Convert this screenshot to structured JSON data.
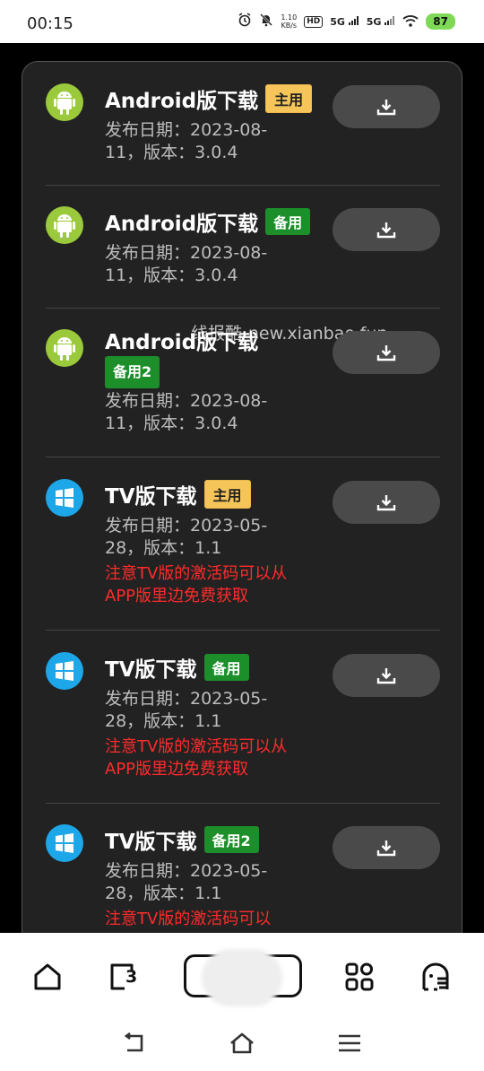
{
  "status_bar": {
    "time": "00:15",
    "net_speed_value": "1.10",
    "net_speed_unit": "KB/s",
    "hd_label": "HD",
    "signal_1": "5G",
    "signal_2": "5G",
    "battery": "87"
  },
  "watermark": "线报酷-new.xianbao.fun",
  "items": [
    {
      "title": "Android版下载",
      "badge": "主用",
      "badge_type": "main",
      "meta": "发布日期：2023-08-11，版本：3.0.4",
      "note": "",
      "icon": "android-icon"
    },
    {
      "title": "Android版下载",
      "badge": "备用",
      "badge_type": "backup",
      "meta": "发布日期：2023-08-11，版本：3.0.4",
      "note": "",
      "icon": "android-icon"
    },
    {
      "title": "Android版下载",
      "badge": "备用2",
      "badge_type": "backup",
      "meta": "发布日期：2023-08-11，版本：3.0.4",
      "note": "",
      "icon": "android-icon"
    },
    {
      "title": "TV版下载",
      "badge": "主用",
      "badge_type": "main",
      "meta": "发布日期：2023-05-28，版本：1.1",
      "note": "注意TV版的激活码可以从APP版里边免费获取",
      "icon": "windows-icon"
    },
    {
      "title": "TV版下载",
      "badge": "备用",
      "badge_type": "backup",
      "meta": "发布日期：2023-05-28，版本：1.1",
      "note": "注意TV版的激活码可以从APP版里边免费获取",
      "icon": "windows-icon"
    },
    {
      "title": "TV版下载",
      "badge": "备用2",
      "badge_type": "backup",
      "meta": "发布日期：2023-05-28，版本：1.1",
      "note": "注意TV版的激活码可以",
      "icon": "windows-icon"
    }
  ],
  "bottom_nav": {
    "tab_count": "3",
    "icons": [
      "home-icon",
      "tabs-icon",
      "apps-icon",
      "ghost-icon"
    ]
  },
  "colors": {
    "badge_main": "#f6c55a",
    "badge_backup": "#1c8e2a",
    "note_red": "#ff2b2b",
    "card_bg": "#222222"
  }
}
